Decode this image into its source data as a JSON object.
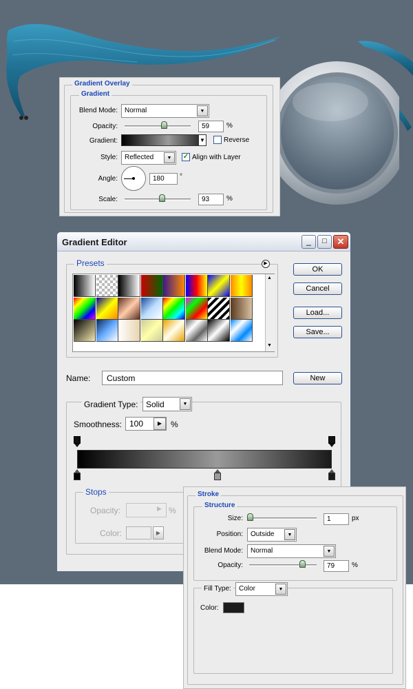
{
  "gradient_overlay": {
    "section_title": "Gradient Overlay",
    "group_title": "Gradient",
    "blend_mode_label": "Blend Mode:",
    "blend_mode_value": "Normal",
    "opacity_label": "Opacity:",
    "opacity_value": "59",
    "opacity_unit": "%",
    "opacity_fraction": 0.59,
    "gradient_label": "Gradient:",
    "reverse_label": "Reverse",
    "reverse_checked": false,
    "style_label": "Style:",
    "style_value": "Reflected",
    "align_label": "Align with Layer",
    "align_checked": true,
    "angle_label": "Angle:",
    "angle_value": "180",
    "angle_unit": "°",
    "scale_label": "Scale:",
    "scale_value": "93",
    "scale_unit": "%",
    "scale_fraction": 0.93
  },
  "gradient_editor": {
    "title": "Gradient Editor",
    "presets_label": "Presets",
    "ok_label": "OK",
    "cancel_label": "Cancel",
    "load_label": "Load...",
    "save_label": "Save...",
    "name_label": "Name:",
    "name_value": "Custom",
    "new_label": "New",
    "gradient_type_label": "Gradient Type:",
    "gradient_type_value": "Solid",
    "smoothness_label": "Smoothness:",
    "smoothness_value": "100",
    "smoothness_unit": "%",
    "stops_label": "Stops",
    "stop_opacity_label": "Opacity:",
    "stop_opacity_unit": "%",
    "stop_color_label": "Color:",
    "color_stops": [
      0.0,
      0.55,
      1.0
    ],
    "gradient_colors": [
      "#000000",
      "#9a9a9a",
      "#1a1a1a"
    ]
  },
  "stroke": {
    "section_title": "Stroke",
    "group_title": "Structure",
    "size_label": "Size:",
    "size_value": "1",
    "size_unit": "px",
    "size_fraction": 0.01,
    "position_label": "Position:",
    "position_value": "Outside",
    "blend_mode_label": "Blend Mode:",
    "blend_mode_value": "Normal",
    "opacity_label": "Opacity:",
    "opacity_value": "79",
    "opacity_unit": "%",
    "opacity_fraction": 0.79,
    "fill_type_label": "Fill Type:",
    "fill_type_value": "Color",
    "color_label": "Color:",
    "color_value": "#1c1c1c"
  },
  "colors": {
    "background": "#5d6b78",
    "accent_blue": "#1d48b8",
    "ribbon": "#2a86a8"
  },
  "icons": {
    "dropdown": "chevron-down-icon",
    "flyout": "triangle-right-icon",
    "minimize": "minimize-icon",
    "maximize": "maximize-icon",
    "close": "close-icon"
  }
}
